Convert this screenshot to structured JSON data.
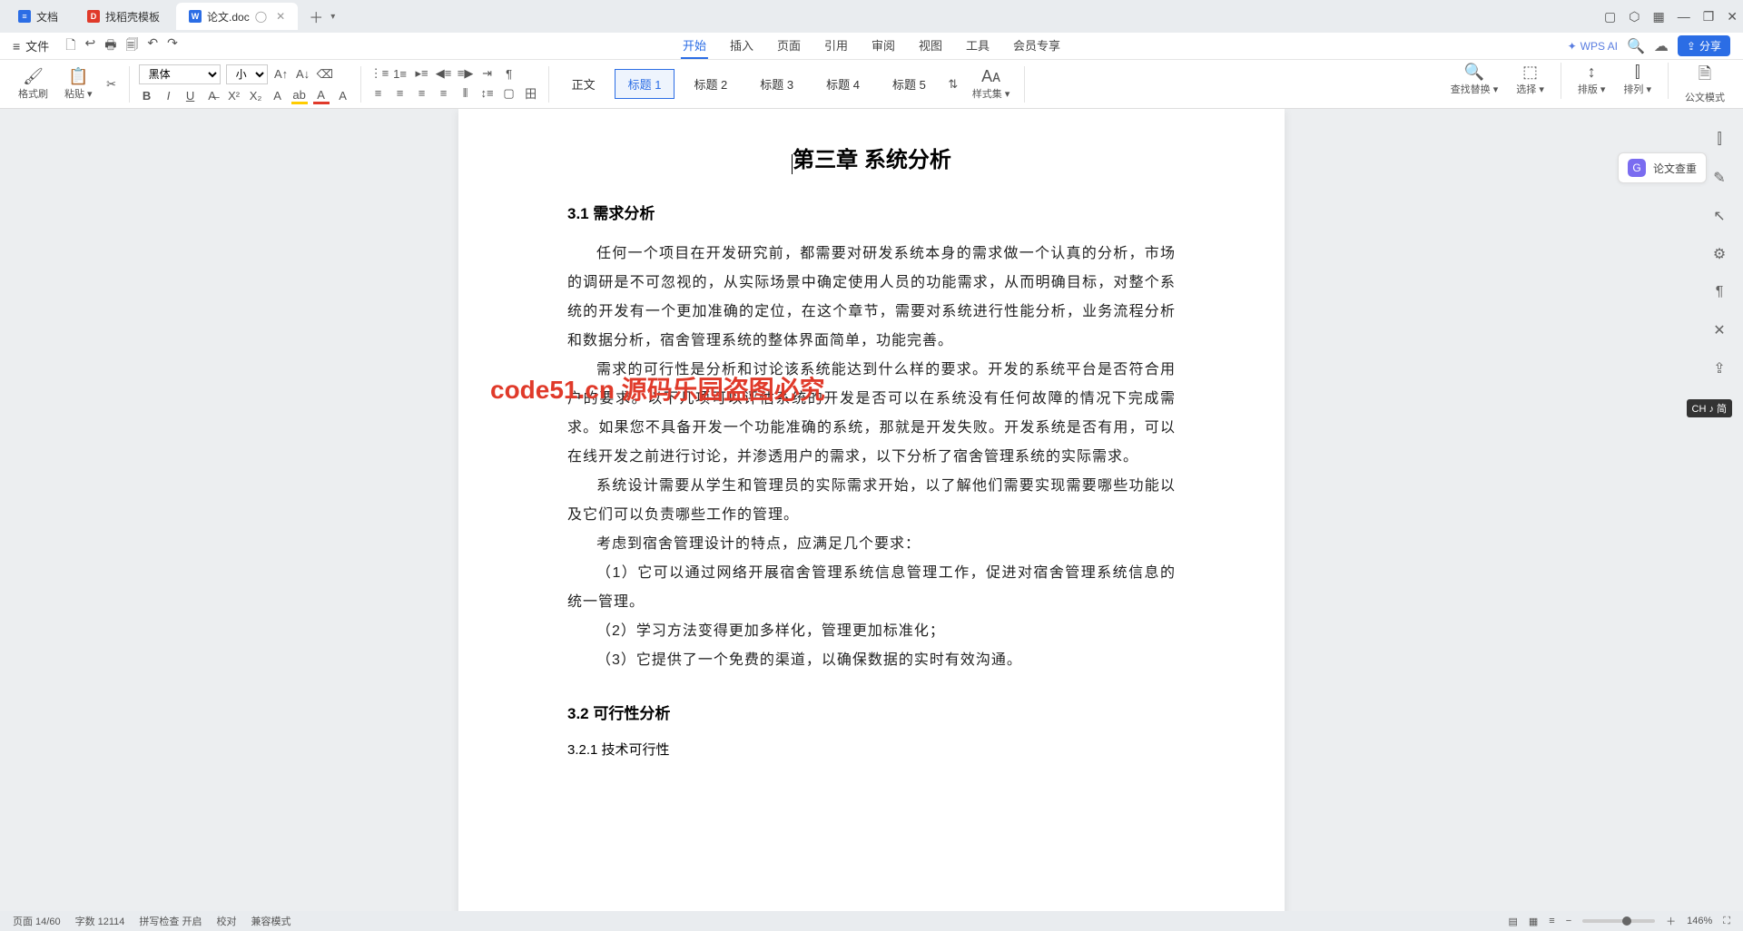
{
  "tabs": [
    {
      "icon_bg": "#2b6de5",
      "icon_text": "≡",
      "label": "文档"
    },
    {
      "icon_bg": "#e03a2a",
      "icon_text": "D",
      "label": "找稻壳模板"
    },
    {
      "icon_bg": "#2b6de5",
      "icon_text": "W",
      "label": "论文.doc",
      "active": true
    }
  ],
  "title_right_icons": [
    "▢",
    "⬡",
    "▦",
    "—",
    "❐",
    "✕"
  ],
  "file_menu": "文件",
  "qat_icons": [
    "🗋",
    "↩",
    "🖶",
    "🗐",
    "↶",
    "↷"
  ],
  "menu_tabs": [
    "开始",
    "插入",
    "页面",
    "引用",
    "审阅",
    "视图",
    "工具",
    "会员专享"
  ],
  "menu_active": 0,
  "wps_ai": "WPS AI",
  "share": "分享",
  "ribbon": {
    "format_painter": "格式刷",
    "paste": "粘贴",
    "font_name": "黑体",
    "font_size": "小三",
    "styles": [
      "正文",
      "标题 1",
      "标题 2",
      "标题 3",
      "标题 4",
      "标题 5"
    ],
    "style_sel": 1,
    "style_set": "样式集",
    "find_replace": "查找替换",
    "select": "选择",
    "sort": "排版",
    "arrange": "排列",
    "gov_mode": "公文模式"
  },
  "doc": {
    "title": "第三章  系统分析",
    "h1": "3.1 需求分析",
    "p1": "任何一个项目在开发研究前，都需要对研发系统本身的需求做一个认真的分析，市场的调研是不可忽视的，从实际场景中确定使用人员的功能需求，从而明确目标，对整个系统的开发有一个更加准确的定位，在这个章节，需要对系统进行性能分析，业务流程分析和数据分析，宿舍管理系统的整体界面简单，功能完善。",
    "p2": "需求的可行性是分析和讨论该系统能达到什么样的要求。开发的系统平台是否符合用户的要求。以下几项可以评估系统的开发是否可以在系统没有任何故障的情况下完成需求。如果您不具备开发一个功能准确的系统，那就是开发失败。开发系统是否有用，可以在线开发之前进行讨论，并渗透用户的需求，以下分析了宿舍管理系统的实际需求。",
    "p3": "系统设计需要从学生和管理员的实际需求开始，以了解他们需要实现需要哪些功能以及它们可以负责哪些工作的管理。",
    "p4": "考虑到宿舍管理设计的特点，应满足几个要求：",
    "p5": "（1）它可以通过网络开展宿舍管理系统信息管理工作，促进对宿舍管理系统信息的统一管理。",
    "p6": "（2）学习方法变得更加多样化，管理更加标准化；",
    "p7": "（3）它提供了一个免费的渠道，以确保数据的实时有效沟通。",
    "h2": "3.2 可行性分析",
    "h3": "3.2.1 技术可行性"
  },
  "thesis_check": "论文查重",
  "ime": "CH ♪ 简",
  "watermark_red": "code51.cn 源码乐园盗图必究",
  "status": {
    "page": "页面 14/60",
    "words": "字数 12114",
    "spell": "拼写检查  开启",
    "proof": "校对",
    "compat": "兼容模式",
    "zoom": "146%"
  }
}
